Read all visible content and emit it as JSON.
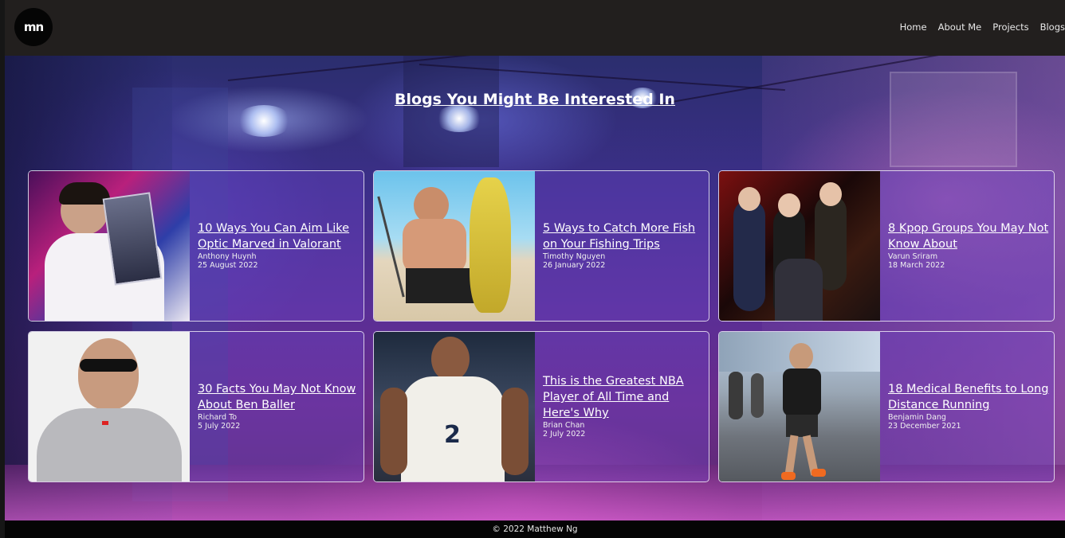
{
  "logo": {
    "text": "mn"
  },
  "nav": {
    "items": [
      "Home",
      "About Me",
      "Projects",
      "Blogs"
    ]
  },
  "section": {
    "title": "Blogs You Might Be Interested In"
  },
  "cards": [
    {
      "title": "10 Ways You Can Aim Like Optic Marved in Valorant",
      "author": "Anthony Huynh",
      "date": "25 August 2022"
    },
    {
      "title": "5 Ways to Catch More Fish on Your Fishing Trips",
      "author": "Timothy Nguyen",
      "date": "26 January 2022"
    },
    {
      "title": "8 Kpop Groups You May Not Know About",
      "author": "Varun Sriram",
      "date": "18 March 2022"
    },
    {
      "title": "30 Facts You May Not Know About Ben Baller",
      "author": "Richard To",
      "date": "5 July 2022"
    },
    {
      "title": "This is the Greatest NBA Player of All Time and Here's Why",
      "author": "Brian Chan",
      "date": "2 July 2022"
    },
    {
      "title": "18 Medical Benefits to Long Distance Running",
      "author": "Benjamin Dang",
      "date": "23 December 2021"
    }
  ],
  "footer": {
    "text": "© 2022 Matthew Ng"
  }
}
